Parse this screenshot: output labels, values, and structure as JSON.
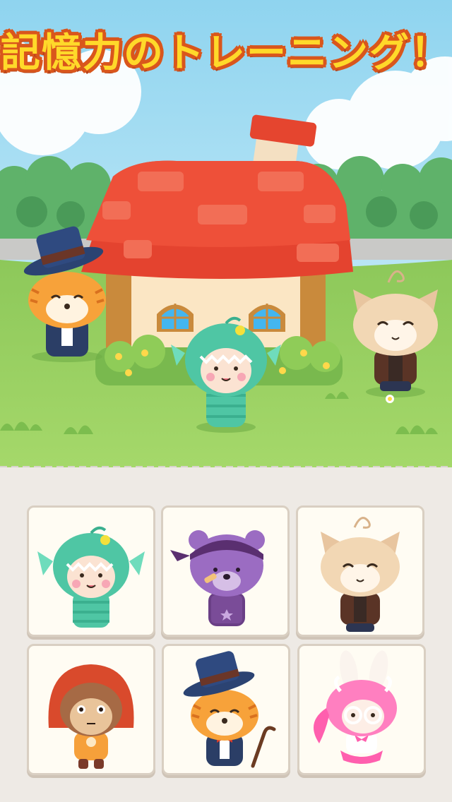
{
  "header": {
    "title": "記憶力のトレーニング！"
  },
  "scene": {
    "characters": [
      "tiger-top-hat-icon",
      "fish-costume-kid-icon",
      "cat-jacket-icon"
    ],
    "colors": {
      "sky": "#b9e6f6",
      "grass": "#8fca5d",
      "roof": "#e64734",
      "wall": "#fbe6c4"
    }
  },
  "choices": [
    {
      "character": "fish-costume-kid-icon"
    },
    {
      "character": "purple-bear-bandana-icon"
    },
    {
      "character": "cat-jacket-icon"
    },
    {
      "character": "monkey-red-hood-icon"
    },
    {
      "character": "tiger-top-hat-cane-icon"
    },
    {
      "character": "pink-bunny-glasses-icon"
    }
  ]
}
